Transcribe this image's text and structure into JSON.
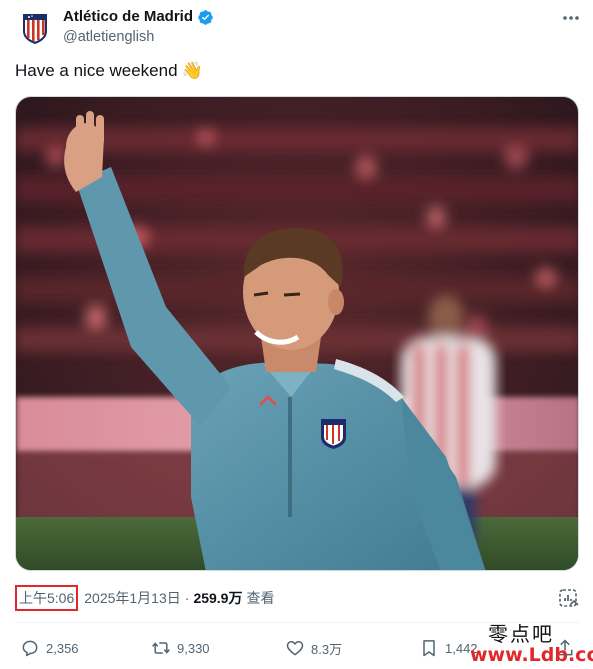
{
  "header": {
    "display_name": "Atlético de Madrid",
    "handle": "@atletienglish",
    "avatar_icon": "atletico-crest-icon",
    "verified_icon": "verified-badge-icon",
    "more_icon": "more-horizontal-icon"
  },
  "tweet": {
    "text": "Have a nice weekend",
    "emoji": "👋",
    "media_alt": "player-waving-photo"
  },
  "meta": {
    "time": "上午5:06",
    "date": "2025年1月13日",
    "separator": "·",
    "views_count": "259.9万",
    "views_label": "查看"
  },
  "actions": {
    "replies": "2,356",
    "retweets": "9,330",
    "likes": "8.3万",
    "bookmarks": "1,442"
  },
  "watermark": {
    "top": "零点吧",
    "bottom": "www.Ldb.cc"
  },
  "colors": {
    "accent_blue": "#1d9bf0",
    "secondary_text": "#536471",
    "highlight_red": "#e0282b"
  }
}
